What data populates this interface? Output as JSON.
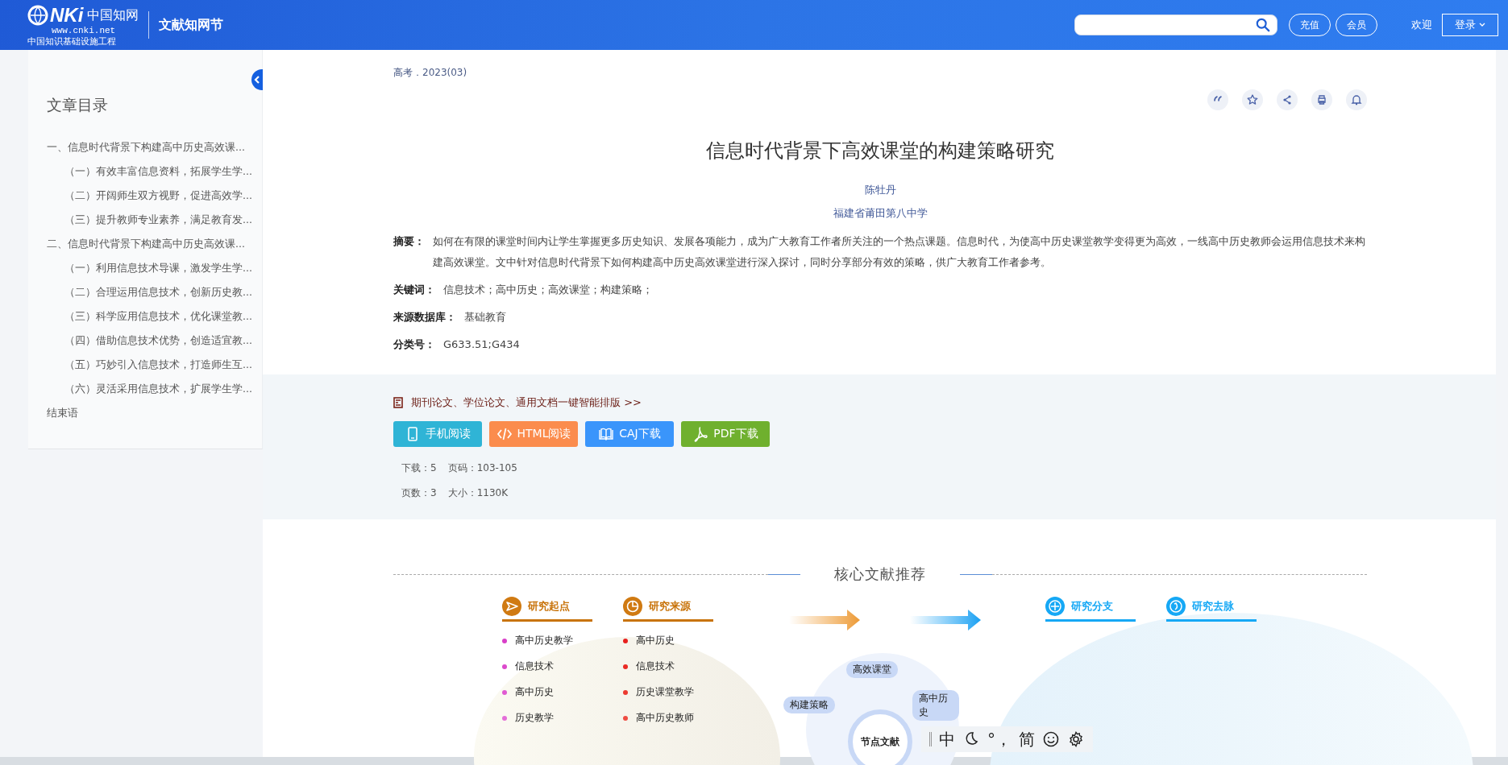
{
  "header": {
    "logo": {
      "mark": "NKi",
      "name": "中国知网",
      "url": "www.cnki.net",
      "tagline": "中国知识基础设施工程"
    },
    "section": "文献知网节",
    "buttons": [
      "充值",
      "会员"
    ],
    "welcome": "欢迎",
    "login": "登录"
  },
  "sidebar": {
    "title": "文章目录",
    "items": [
      {
        "text": "一、信息时代背景下构建高中历史高效课...",
        "children": [
          {
            "text": "（一）有效丰富信息资料，拓展学生学..."
          },
          {
            "text": "（二）开阔师生双方视野，促进高效学..."
          },
          {
            "text": "（三）提升教师专业素养，满足教育发..."
          }
        ]
      },
      {
        "text": "二、信息时代背景下构建高中历史高效课...",
        "children": [
          {
            "text": "（一）利用信息技术导课，激发学生学..."
          },
          {
            "text": "（二）合理运用信息技术，创新历史教..."
          },
          {
            "text": "（三）科学应用信息技术，优化课堂教..."
          },
          {
            "text": "（四）借助信息技术优势，创造适宜教..."
          },
          {
            "text": "（五）巧妙引入信息技术，打造师生互..."
          },
          {
            "text": "（六）灵活采用信息技术，扩展学生学..."
          }
        ]
      },
      {
        "text": "结束语"
      }
    ]
  },
  "article": {
    "journal": "高考．2023(03)",
    "tools": [
      {
        "kind": "quote"
      },
      {
        "kind": "star"
      },
      {
        "kind": "share"
      },
      {
        "kind": "print"
      },
      {
        "kind": "bell"
      }
    ],
    "title": "信息时代背景下高效课堂的构建策略研究",
    "author": "陈牡丹",
    "affiliation": "福建省莆田第八中学",
    "fields": [
      {
        "label": "摘要：",
        "value": "如何在有限的课堂时间内让学生掌握更多历史知识、发展各项能力，成为广大教育工作者所关注的一个热点课题。信息时代，为使高中历史课堂教学变得更为高效，一线高中历史教师会运用信息技术来构建高效课堂。文中针对信息时代背景下如何构建高中历史高效课堂进行深入探讨，同时分享部分有效的策略，供广大教育工作者参考。"
      },
      {
        "label": "关键词：",
        "value": "信息技术；高中历史；高效课堂；构建策略；"
      },
      {
        "label": "来源数据库：",
        "value": "基础教育"
      },
      {
        "label": "分类号：",
        "value": "G633.51;G434"
      }
    ]
  },
  "downloads": {
    "promo": "期刊论文、学位论文、通用文档一键智能排版 >>",
    "buttons": [
      {
        "kind": "mobile",
        "label": "手机阅读"
      },
      {
        "kind": "html",
        "label": "HTML阅读"
      },
      {
        "kind": "caj",
        "label": "CAJ下载"
      },
      {
        "kind": "pdf",
        "label": "PDF下载"
      }
    ],
    "stats": [
      [
        "下载：5",
        "页码：103-105"
      ],
      [
        "页数：3",
        "大小：1130K"
      ]
    ]
  },
  "recommend": {
    "title": "核心文献推荐",
    "columns": [
      {
        "title": "研究起点",
        "kind": "origin",
        "items": [
          {
            "text": "高中历史教学",
            "color": "#d93fc8"
          },
          {
            "text": "信息技术",
            "color": "#dc4acc"
          },
          {
            "text": "高中历史",
            "color": "#e05ad2"
          },
          {
            "text": "历史教学",
            "color": "#e46ed8"
          }
        ]
      },
      {
        "title": "研究来源",
        "kind": "source",
        "items": [
          {
            "text": "高中历史",
            "color": "#e8201e"
          },
          {
            "text": "信息技术",
            "color": "#ea2a24"
          },
          {
            "text": "历史课堂教学",
            "color": "#ec3a30"
          },
          {
            "text": "高中历史教师",
            "color": "#ee4c42"
          }
        ]
      },
      {
        "title": "研究分支",
        "kind": "branch"
      },
      {
        "title": "研究去脉",
        "kind": "trend"
      }
    ],
    "nodes": {
      "center": "节点文献",
      "around": [
        "高效课堂",
        "构建策略",
        "高中历史"
      ]
    }
  },
  "ime": [
    {
      "kind": "text",
      "label": "中"
    },
    {
      "kind": "moon"
    },
    {
      "kind": "text",
      "label": "°，"
    },
    {
      "kind": "text",
      "label": "简"
    },
    {
      "kind": "smile"
    },
    {
      "kind": "gear"
    }
  ]
}
